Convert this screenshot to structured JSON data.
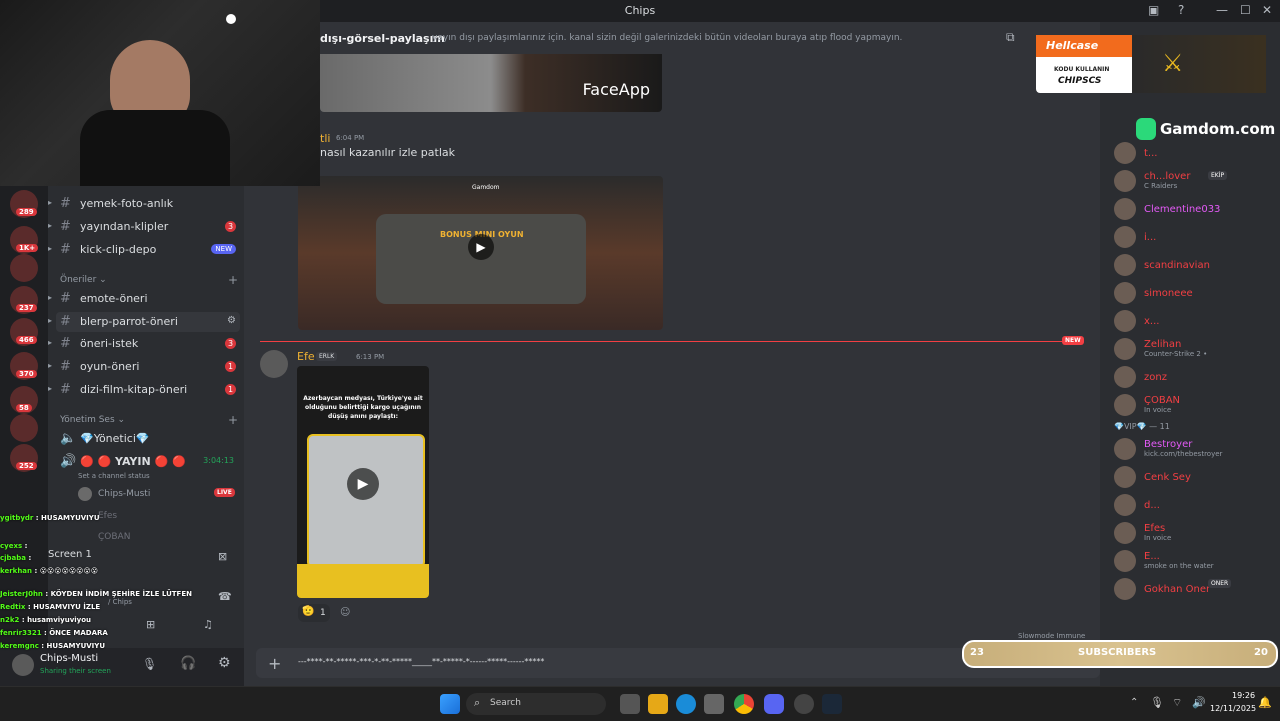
{
  "window": {
    "title": "Chips"
  },
  "channels": {
    "top": [
      {
        "name": "yemek-foto-anlık",
        "icon": "📝"
      },
      {
        "name": "yayından-klipler",
        "icon": "💾",
        "count": "3"
      },
      {
        "name": "kick-clip-depo",
        "icon": "💾",
        "badge": "NEW"
      }
    ],
    "category1": "Öneriler",
    "oneriler": [
      {
        "name": "emote-öneri",
        "icon": "💢"
      },
      {
        "name": "blerp-parrot-öneri",
        "icon": "❇️"
      },
      {
        "name": "öneri-istek",
        "icon": "❓",
        "count": "3"
      },
      {
        "name": "oyun-öneri",
        "icon": "🎯",
        "count": "1"
      },
      {
        "name": "dizi-film-kitap-öneri",
        "icon": "🎬",
        "count": "1"
      }
    ],
    "category2": "Yönetim Ses",
    "voice": [
      {
        "name": "💎Yönetici💎"
      },
      {
        "name": "🔴 🔴 YAYIN 🔴 🔴",
        "time": "3:04:13",
        "status": "Set a channel status"
      }
    ],
    "voice_users": [
      "Chips-Musti",
      "Efes",
      "ÇOBAN"
    ],
    "live_label": "LIVE"
  },
  "servers": [
    {
      "badge": "289"
    },
    {
      "badge": "1K+"
    },
    {
      "badge": ""
    },
    {
      "badge": "237"
    },
    {
      "badge": "466"
    },
    {
      "badge": "370"
    },
    {
      "badge": "58"
    },
    {
      "badge": ""
    },
    {
      "badge": "252"
    }
  ],
  "screen_share": {
    "title": "Screen 1",
    "subtitle": "/ Chips"
  },
  "user_panel": {
    "name": "Chips-Musti",
    "status": "Sharing their screen"
  },
  "chat_header": {
    "channel": "dışı-görsel-paylaşım",
    "topic": "yayın dışı paylaşımlarınız için. kanal sizin değil galerinizdeki bütün videoları buraya atıp flood yapmayın."
  },
  "messages": [
    {
      "author": "tli",
      "time": "6:04 PM",
      "text": "nasıl kazanılır izle patlak",
      "embed_title": "BONUS MINI OYUN",
      "embed_site": "Gamdom"
    },
    {
      "author": "Efe",
      "tag": "ERLK",
      "time": "6:13 PM",
      "video_caption": "Azerbaycan medyası, Türkiye'ye ait olduğunu belirttiği kargo uçağının düşüş anını paylaştı:",
      "reaction_count": "1"
    }
  ],
  "new_divider": "NEW",
  "faceapp_label": "FaceApp",
  "composer": {
    "placeholder": "---****-**-*****-***-*-**-*****_____**-*****-*------*****------*****"
  },
  "slowmode": "Slowmode Immune",
  "members": {
    "list": [
      {
        "name": "t...",
        "status": "",
        "color": "#f23f43"
      },
      {
        "name": "ch...lover",
        "tag": "EKİP",
        "status": "C Raiders",
        "color": "#f23f43"
      },
      {
        "name": "Clementine033",
        "status": "",
        "color": "#e35af6"
      },
      {
        "name": "i...",
        "status": "",
        "color": "#f23f43"
      },
      {
        "name": "scandinavian",
        "status": "",
        "color": "#f23f43"
      },
      {
        "name": "simoneee",
        "status": "",
        "color": "#f23f43"
      },
      {
        "name": "x...",
        "status": "",
        "color": "#f23f43"
      },
      {
        "name": "Zelihan",
        "status": "Counter-Strike 2 •",
        "color": "#f23f43"
      },
      {
        "name": "zonz",
        "status": "",
        "color": "#f23f43"
      },
      {
        "name": "ÇOBAN",
        "status": "In voice",
        "color": "#f23f43"
      }
    ],
    "vip_header": "💎VIP💎 — 11",
    "vip": [
      {
        "name": "Bestroyer",
        "status": "kick.com/thebestroyer",
        "color": "#e35af6"
      },
      {
        "name": "Cenk Sey",
        "status": "",
        "color": "#f23f43"
      },
      {
        "name": "d...",
        "status": "",
        "color": "#f23f43"
      },
      {
        "name": "Efes",
        "status": "In voice",
        "color": "#f23f43"
      },
      {
        "name": "E...",
        "status": "smoke on the water",
        "color": "#f23f43"
      },
      {
        "name": "Gokhan Oner",
        "tag": "ONER",
        "status": "",
        "color": "#f23f43"
      }
    ]
  },
  "overlay": {
    "hellcase": {
      "brand": "Hellcase",
      "line1": "KODU KULLANIN",
      "line2": "CHIPSCS"
    },
    "gamdom": "Gamdom.com",
    "subscribers": {
      "left": "23",
      "label": "SUBSCRIBERS",
      "right": "20"
    }
  },
  "stream_chat": [
    {
      "user": "ygitbydr",
      "text": "HUSAMYUVIYU"
    },
    {
      "user": "cyexs",
      "text": ""
    },
    {
      "user": "cjbaba",
      "text": ""
    },
    {
      "user": "kerkhan",
      "text": "😮😮😮😮😮😮😮😮"
    },
    {
      "user": "JeisterJ0hn",
      "text": "KÖYDEN İNDİM ŞEHİRE İZLE LÜTFEN"
    },
    {
      "user": "Redtix",
      "text": "HUSAMVIYU İZLE"
    },
    {
      "user": "n2k2",
      "text": "husamviyuviyou"
    },
    {
      "user": "fenrir3321",
      "text": "ÖNCE MADARA"
    },
    {
      "user": "keremgnc",
      "text": "HUSAMYUVIYU"
    }
  ],
  "taskbar": {
    "search": "Search",
    "time": "19:26",
    "date": "12/11/2025"
  }
}
